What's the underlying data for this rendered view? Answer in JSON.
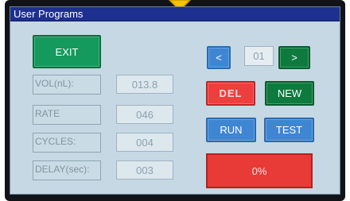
{
  "window": {
    "title": "User Programs"
  },
  "buttons": {
    "exit": "EXIT",
    "prev": "<",
    "next": ">",
    "del": "DEL",
    "new": "NEW",
    "run": "RUN",
    "test": "TEST"
  },
  "program_number": "01",
  "params": [
    {
      "label": "VOL(nL):",
      "value": "013.8"
    },
    {
      "label": "RATE",
      "value": "046"
    },
    {
      "label": "CYCLES:",
      "value": "004"
    },
    {
      "label": "DELAY(sec):",
      "value": "003"
    }
  ],
  "progress": {
    "text": "0%",
    "fraction": 0
  },
  "colors": {
    "titlebar": "#1d2f8f",
    "screen_bg": "#c5d8e3",
    "green": "#0e7a3e",
    "blue": "#3f86d2",
    "red": "#e83a36",
    "marker": "#f5c400"
  },
  "icons": {
    "top_marker": "warning-triangle-icon"
  }
}
